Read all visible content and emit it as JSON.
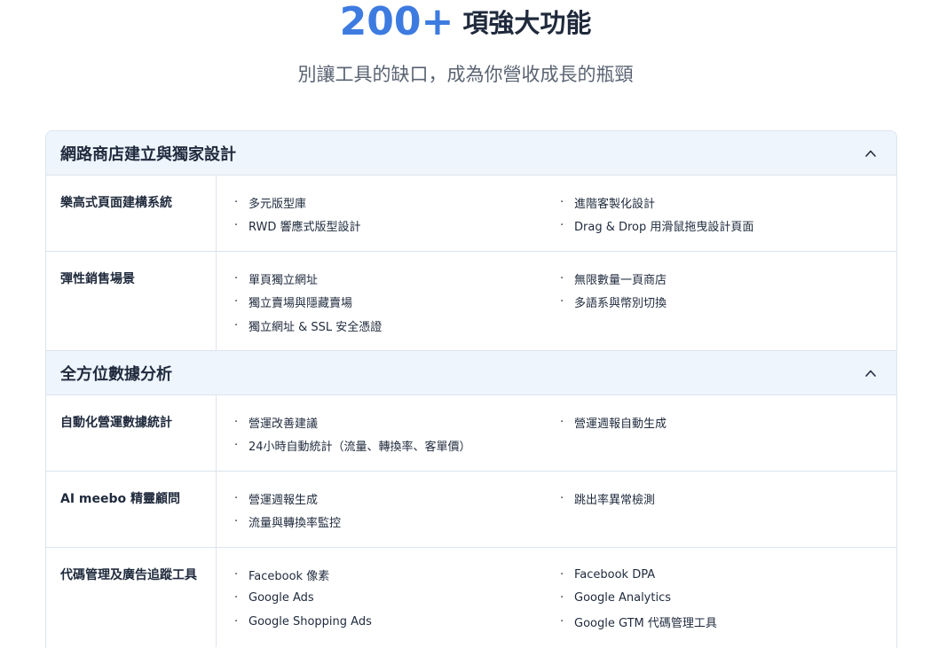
{
  "hero": {
    "number": "200+",
    "title": "項強大功能",
    "subtitle": "別讓工具的缺口，成為你營收成長的瓶頸"
  },
  "sections": [
    {
      "title": "網路商店建立與獨家設計",
      "rows": [
        {
          "label": "樂高式頁面建構系統",
          "left": [
            "多元版型庫",
            "RWD 響應式版型設計"
          ],
          "right": [
            "進階客製化設計",
            "Drag & Drop 用滑鼠拖曳設計頁面"
          ]
        },
        {
          "label": "彈性銷售場景",
          "left": [
            "單頁獨立網址",
            "獨立賣場與隱藏賣場",
            "獨立網址 & SSL 安全憑證"
          ],
          "right": [
            "無限數量一頁商店",
            "多語系與幣別切換"
          ]
        }
      ]
    },
    {
      "title": "全方位數據分析",
      "rows": [
        {
          "label": "自動化營運數據統計",
          "left": [
            "營運改善建議",
            "24小時自動統計（流量、轉換率、客單價）"
          ],
          "right": [
            "營運週報自動生成"
          ]
        },
        {
          "label": "AI meebo 精靈顧問",
          "left": [
            "營運週報生成",
            "流量與轉換率監控"
          ],
          "right": [
            "跳出率異常檢測"
          ]
        },
        {
          "label": "代碼管理及廣告追蹤工具",
          "left": [
            "Facebook 像素",
            "Google Ads",
            "Google Shopping Ads"
          ],
          "right": [
            "Facebook DPA",
            "Google Analytics",
            "Google GTM 代碼管理工具"
          ]
        }
      ]
    }
  ],
  "bullet": "·",
  "colors": {
    "accent": "#3d7be0",
    "header_bg": "#eef5fd",
    "border": "#dde4ec"
  },
  "icons": {
    "toggle": "chevron-up-icon"
  }
}
